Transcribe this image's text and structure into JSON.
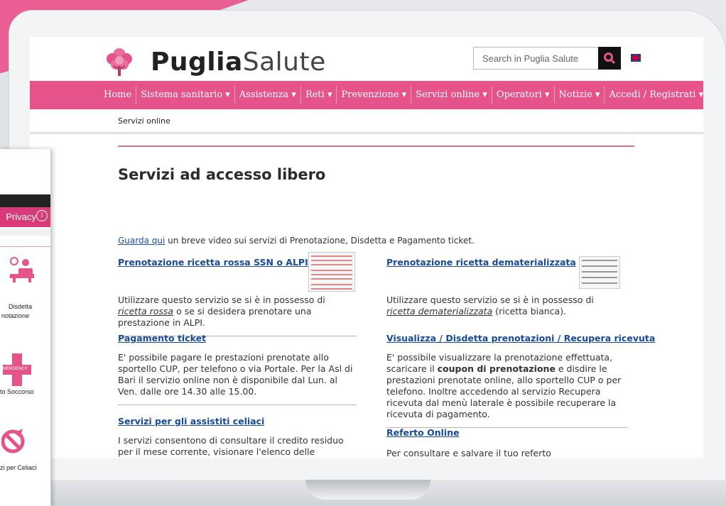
{
  "site": {
    "logo_bold": "Puglia",
    "logo_light": "Salute",
    "search_placeholder": "Search in Puglia Salute"
  },
  "nav": [
    {
      "label": "Home"
    },
    {
      "label": "Sistema sanitario ▾"
    },
    {
      "label": "Assistenza ▾"
    },
    {
      "label": "Reti ▾"
    },
    {
      "label": "Prevenzione ▾"
    },
    {
      "label": "Servizi online ▾"
    },
    {
      "label": "Operatori ▾"
    },
    {
      "label": "Notizie ▾"
    },
    {
      "label": "Accedi / Registrati ▾"
    }
  ],
  "breadcrumb": "Servizi online",
  "page_title": "Servizi ad accesso libero",
  "intro": {
    "link": "Guarda qui",
    "text": " un breve video sui servizi di Prenotazione, Disdetta e Pagamento ticket."
  },
  "cards": {
    "rossa": {
      "title": "Prenotazione ricetta rossa SSN o ALPI",
      "text_pre": "Utilizzare questo servizio se si è in possesso di ",
      "text_em": "ricetta rossa",
      "text_post": " o se si desidera prenotare una prestazione in ALPI."
    },
    "demat": {
      "title": "Prenotazione ricetta dematerializzata",
      "text_pre": "Utilizzare questo servizio se si è in possesso di ",
      "text_em": "ricetta dematerializzata",
      "text_post": " (ricetta bianca)."
    },
    "ticket": {
      "title": "Pagamento ticket",
      "text": "E' possibile pagare le prestazioni prenotate allo sportello CUP, per telefono o via Portale. Per la Asl di Bari il servizio online non è disponibile dal Lun. al Ven. dalle ore 14.30 alle 15.00."
    },
    "visualizza": {
      "title": "Visualizza / Disdetta prenotazioni / Recupera ricevuta",
      "text_pre": "E' possibile visualizzare la prenotazione effettuata, scaricare il ",
      "text_bold": "coupon di prenotazione",
      "text_post": " e disdire le prestazioni prenotate online, allo sportello CUP o per telefono. Inoltre accedendo al servizio Recupera ricevuta dal menù laterale è possibile recuperare la ricevuta di pagamento."
    },
    "celiaci": {
      "title": "Servizi per gli assistiti celiaci",
      "text": "I servizi consentono di consultare il credito residuo per il mese corrente, visionare l'elenco delle operazioni effettuate"
    },
    "referto": {
      "title": "Referto Online",
      "text": "Per consultare e salvare il tuo referto"
    }
  },
  "phone": {
    "privacy": "Privacy",
    "item1_line1": "Disdetta",
    "item1_line2": "notazione",
    "item2": "to Soccorso",
    "emergency": "MERGENCY",
    "item3": "zi per Celiaci"
  },
  "colors": {
    "brand_pink": "#e6538a",
    "link_blue": "#174a9c"
  }
}
